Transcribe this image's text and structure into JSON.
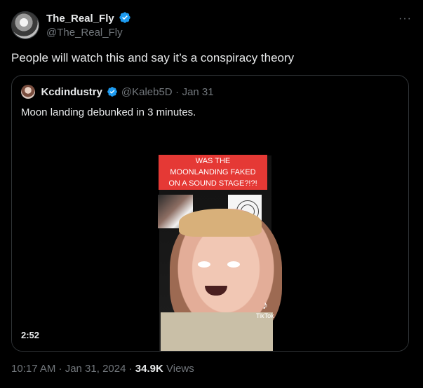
{
  "tweet": {
    "author_name": "The_Real_Fly",
    "author_handle": "@The_Real_Fly",
    "text": "People will watch this and say it’s a conspiracy theory",
    "timestamp": "10:17 AM · Jan 31, 2024",
    "separator": "·",
    "views_count": "34.9K",
    "views_label": "Views",
    "more_label": "···"
  },
  "quote": {
    "author_name": "Kcdindustry",
    "author_handle": "@Kaleb5D",
    "separator": "·",
    "date": "Jan 31",
    "text": "Moon landing debunked in 3 minutes.",
    "video": {
      "caption_lines": [
        "WAS THE",
        "MOONLANDING FAKED",
        "ON A SOUND STAGE?!?!"
      ],
      "duration": "2:52",
      "watermark": "TikTok"
    }
  },
  "colors": {
    "background": "#000000",
    "text_primary": "#e7e9ea",
    "text_secondary": "#71767b",
    "border": "#2f3336",
    "verified_blue": "#1d9bf0",
    "caption_red": "#e53935"
  },
  "icons": {
    "verified": "verified-badge-icon",
    "more": "more-options-icon",
    "tiktok": "tiktok-logo-icon"
  }
}
